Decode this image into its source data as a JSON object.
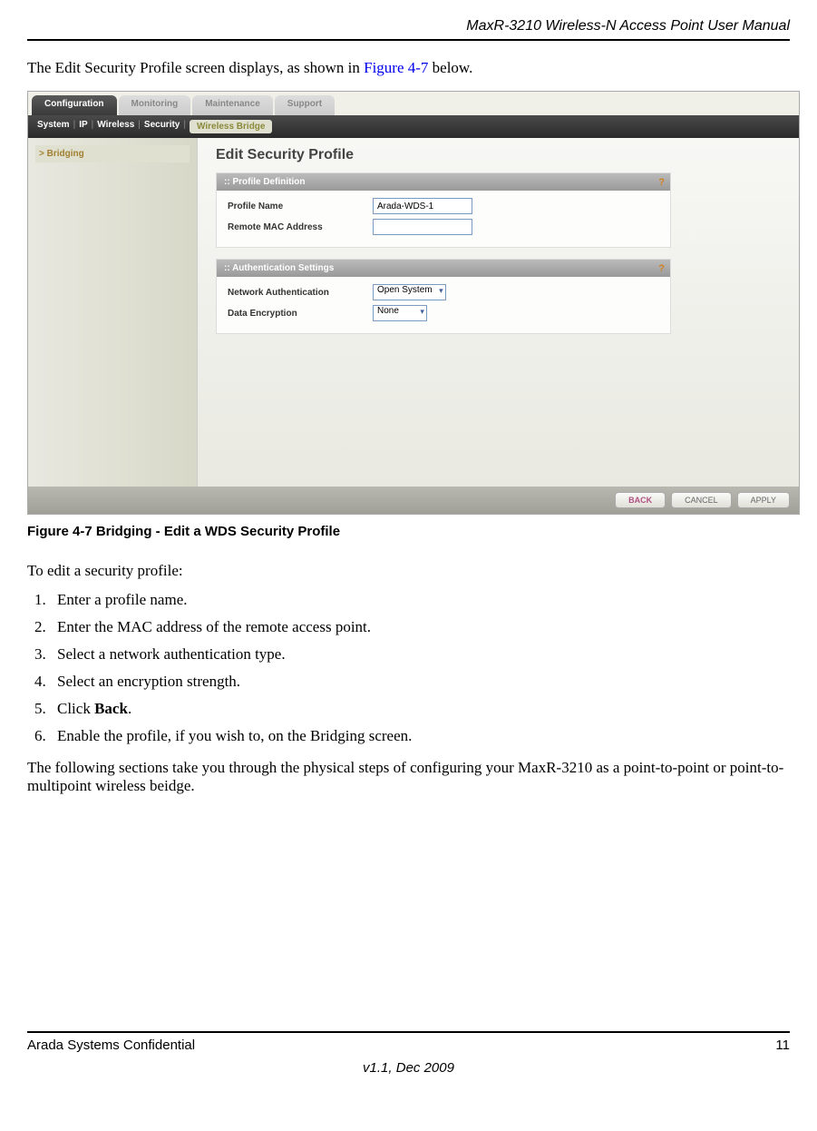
{
  "header": {
    "title": "MaxR-3210 Wireless-N Access Point User Manual"
  },
  "intro": {
    "pre": "The Edit Security Profile screen displays, as shown in ",
    "figure_ref": "Figure 4-7",
    "post": " below."
  },
  "screenshot": {
    "main_tabs": [
      "Configuration",
      "Monitoring",
      "Maintenance",
      "Support"
    ],
    "active_main_tab": 0,
    "subnav": {
      "items": [
        "System",
        "IP",
        "Wireless",
        "Security"
      ],
      "separator": "|",
      "active": "Wireless Bridge"
    },
    "sidebar": {
      "item": "> Bridging"
    },
    "content_title": "Edit Security Profile",
    "panels": [
      {
        "title": ":: Profile Definition",
        "fields": [
          {
            "label": "Profile Name",
            "value": "Arada-WDS-1",
            "type": "text"
          },
          {
            "label": "Remote MAC Address",
            "value": "",
            "type": "text"
          }
        ]
      },
      {
        "title": ":: Authentication Settings",
        "fields": [
          {
            "label": "Network Authentication",
            "value": "Open System",
            "type": "select"
          },
          {
            "label": "Data Encryption",
            "value": "None",
            "type": "select"
          }
        ]
      }
    ],
    "help_icon": "?",
    "buttons": {
      "back": "BACK",
      "cancel": "CANCEL",
      "apply": "APPLY"
    }
  },
  "figure_caption": "Figure 4-7  Bridging - Edit a WDS Security Profile",
  "instructions": {
    "intro": "To edit a security profile:",
    "steps": [
      "Enter a profile name.",
      "Enter the MAC address of the remote access point.",
      "Select a network authentication type.",
      "Select an encryption strength.",
      {
        "pre": "Click ",
        "bold": "Back",
        "post": "."
      },
      "Enable the profile, if you wish to, on the Bridging screen."
    ],
    "followup": "The following sections take you through the physical steps of configuring your MaxR-3210 as a point-to-point or point-to-multipoint wireless beidge."
  },
  "footer": {
    "left": "Arada Systems Confidential",
    "right": "11",
    "center": "v1.1, Dec 2009"
  }
}
